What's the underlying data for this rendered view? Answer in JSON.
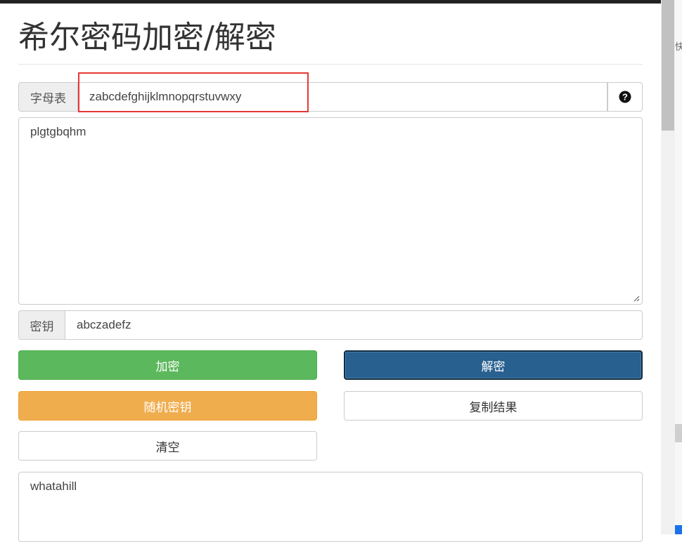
{
  "page": {
    "title": "希尔密码加密/解密"
  },
  "alphabet": {
    "label": "字母表",
    "value": "zabcdefghijklmnopqrstuvwxy",
    "help_icon": "question-circle-icon"
  },
  "input_text": {
    "value": "plgtgbqhm"
  },
  "key": {
    "label": "密钥",
    "value": "abczadefz"
  },
  "buttons": {
    "encrypt": "加密",
    "decrypt": "解密",
    "random_key": "随机密钥",
    "copy_result": "复制结果",
    "clear": "清空"
  },
  "output_text": {
    "value": "whatahill"
  },
  "side_panel": {
    "glyph": "快"
  },
  "colors": {
    "encrypt": "#5cb85c",
    "decrypt": "#286090",
    "random_key": "#f0ad4e",
    "highlight": "#e53935"
  }
}
